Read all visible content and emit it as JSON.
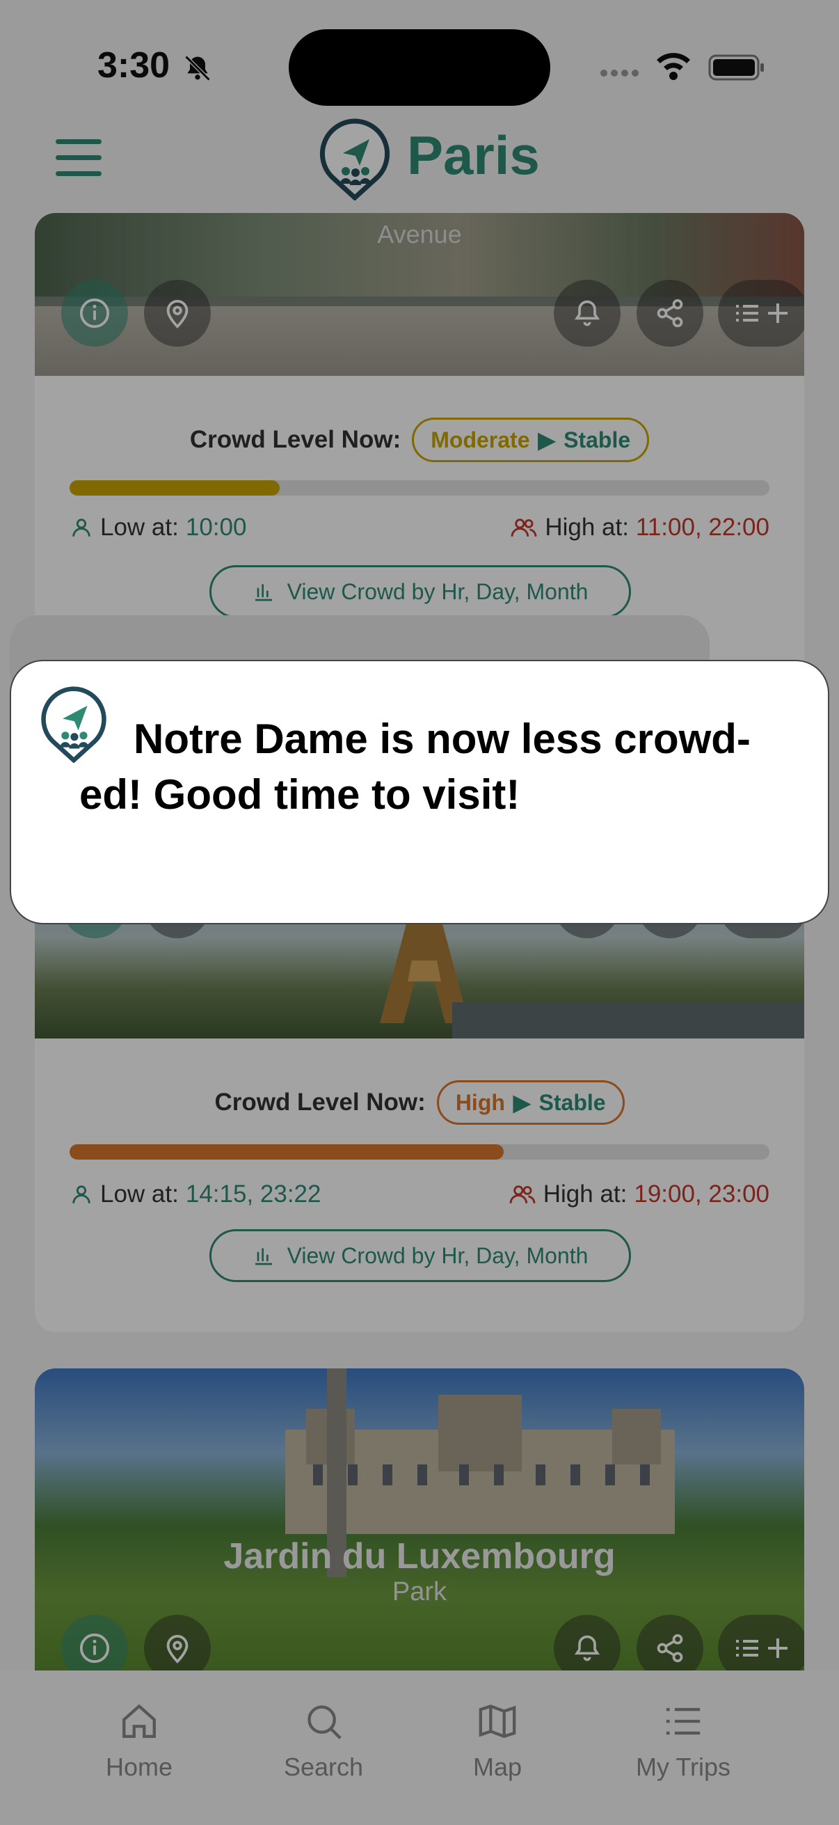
{
  "status": {
    "time": "3:30"
  },
  "header": {
    "title": "Paris"
  },
  "cards": [
    {
      "subtitle": "Avenue",
      "crowd_label": "Crowd Level Now:",
      "level": "Moderate",
      "trend": "Stable",
      "level_color": "#c9a400",
      "level_fraction": 0.3,
      "low_label": "Low at:",
      "low_times": "10:00",
      "high_label": "High at:",
      "high_times": "11:00, 22:00",
      "view_label": "View Crowd by Hr, Day, Month"
    },
    {
      "crowd_label": "Crowd Level Now:",
      "level": "High",
      "trend": "Stable",
      "level_color": "#d9772e",
      "level_fraction": 0.62,
      "low_label": "Low at:",
      "low_times": "14:15, 23:22",
      "high_label": "High at:",
      "high_times": "19:00, 23:00",
      "view_label": "View Crowd by Hr, Day, Month"
    },
    {
      "title": "Jardin du Luxembourg",
      "subtitle": "Park"
    }
  ],
  "notification": {
    "message": "Notre Dame is now less crowd-ed! Good time to visit!"
  },
  "tabs": [
    {
      "label": "Home",
      "icon": "home-icon"
    },
    {
      "label": "Search",
      "icon": "search-icon"
    },
    {
      "label": "Map",
      "icon": "map-icon"
    },
    {
      "label": "My Trips",
      "icon": "list-icon"
    }
  ],
  "colors": {
    "accent": "#2f8a74",
    "low": "#2f8a74",
    "high": "#c0392b",
    "trend": "#2f8a74"
  }
}
